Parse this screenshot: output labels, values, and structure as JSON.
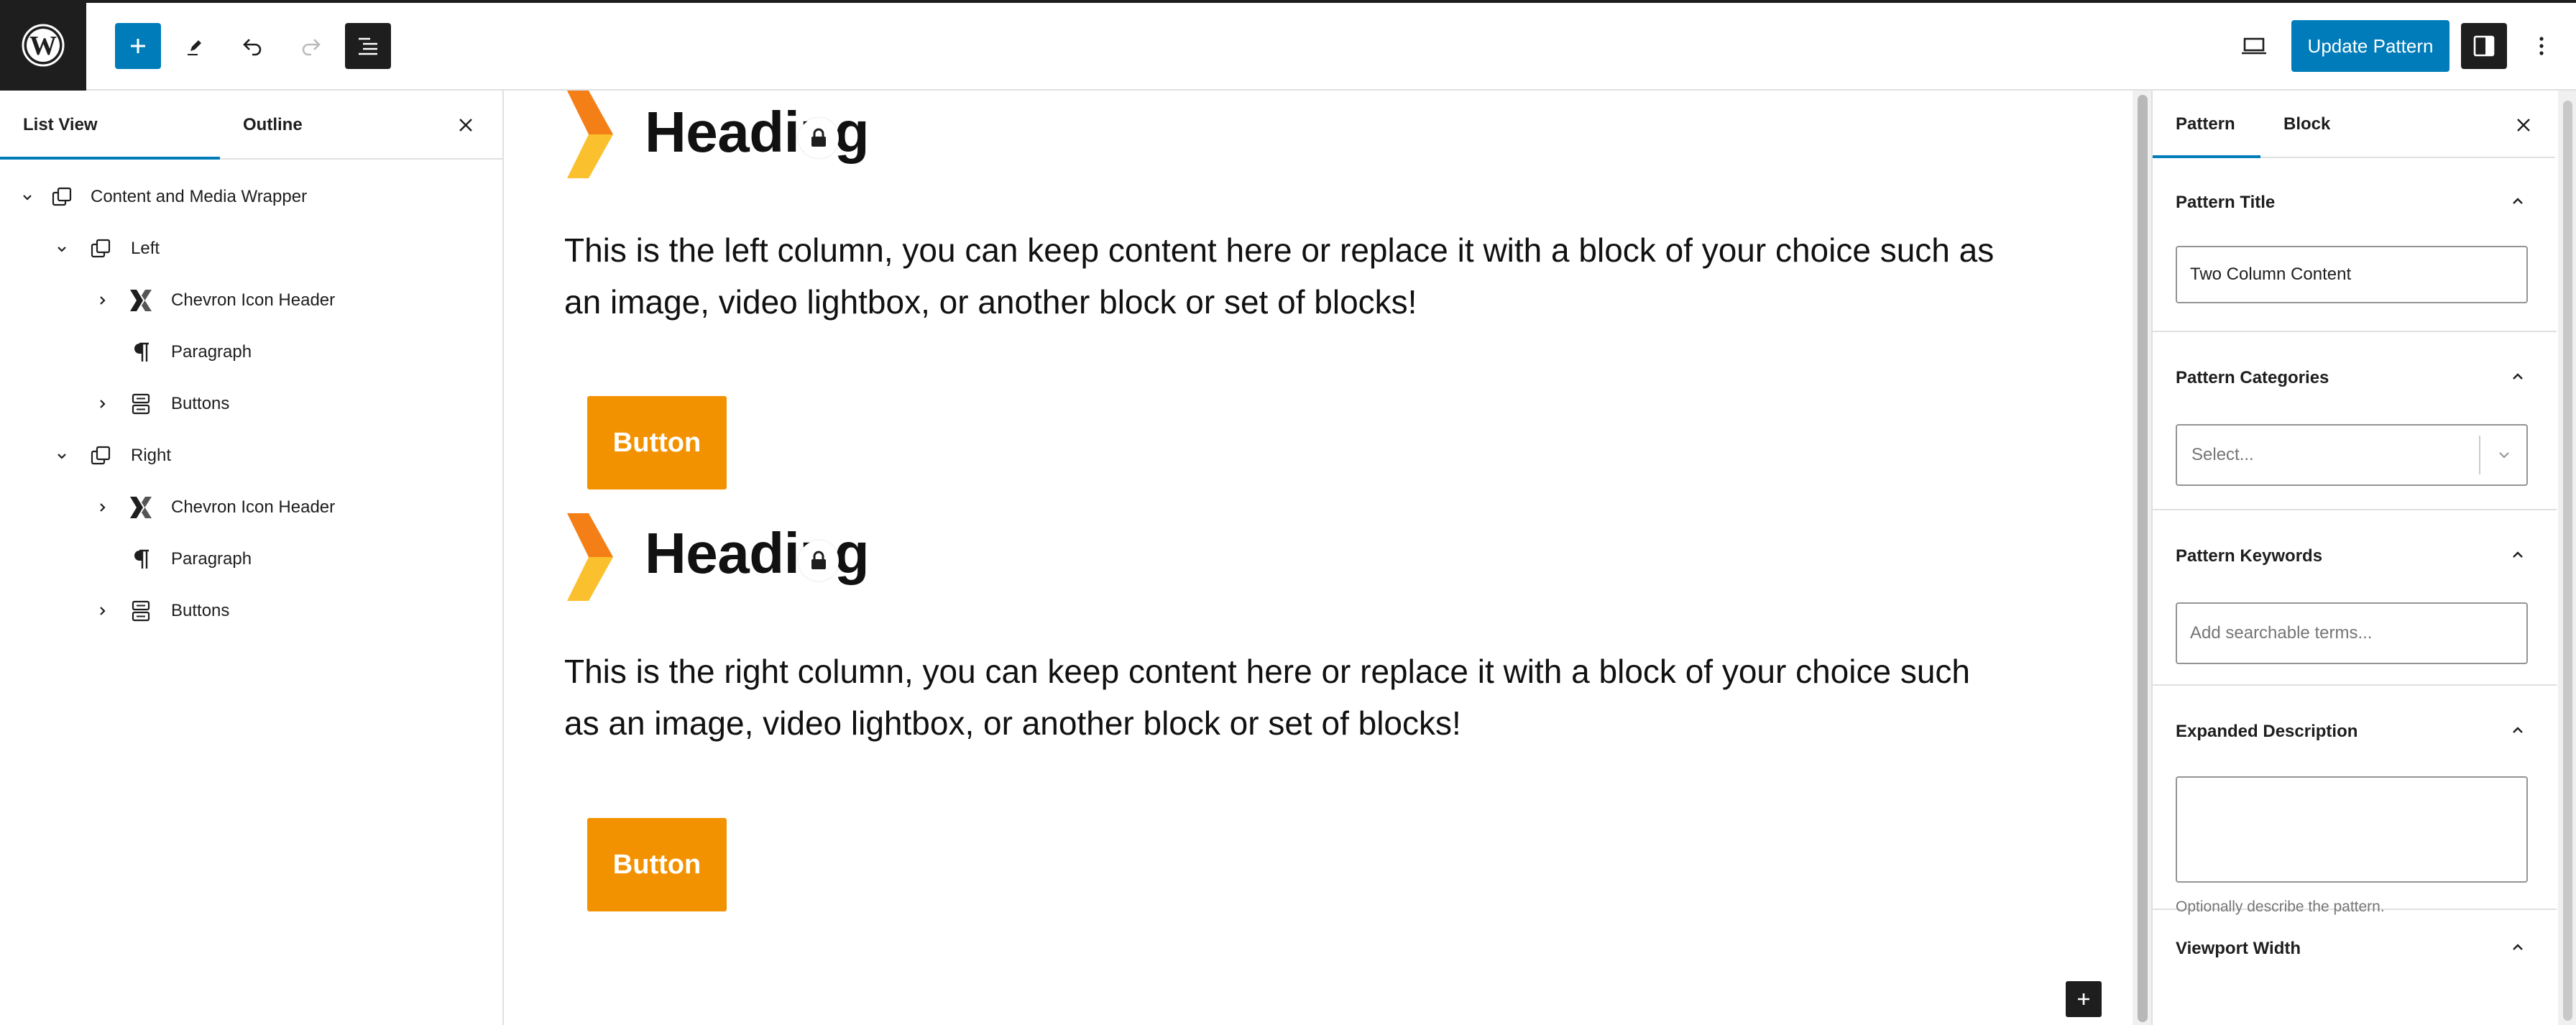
{
  "toolbar": {
    "logo": "wordpress-logo",
    "update_label": "Update Pattern",
    "icons": [
      "plus-icon",
      "pencil-icon",
      "undo-icon",
      "redo-icon",
      "list-view-icon",
      "desktop-preview-icon",
      "sidebar-settings-icon",
      "more-vertical-icon"
    ]
  },
  "left_panel": {
    "tabs": [
      {
        "label": "List View",
        "active": true
      },
      {
        "label": "Outline",
        "active": false
      }
    ],
    "tree": [
      {
        "label": "Content and Media Wrapper",
        "level": 1,
        "expanded": true,
        "icon": "group-icon"
      },
      {
        "label": "Left",
        "level": 2,
        "expanded": true,
        "icon": "group-icon"
      },
      {
        "label": "Chevron Icon Header",
        "level": 3,
        "expanded": false,
        "icon": "chevron-header-icon"
      },
      {
        "label": "Paragraph",
        "level": 3,
        "expanded": null,
        "icon": "paragraph-icon"
      },
      {
        "label": "Buttons",
        "level": 3,
        "expanded": false,
        "icon": "buttons-icon"
      },
      {
        "label": "Right",
        "level": 2,
        "expanded": true,
        "icon": "group-icon"
      },
      {
        "label": "Chevron Icon Header",
        "level": 3,
        "expanded": false,
        "icon": "chevron-header-icon"
      },
      {
        "label": "Paragraph",
        "level": 3,
        "expanded": null,
        "icon": "paragraph-icon"
      },
      {
        "label": "Buttons",
        "level": 3,
        "expanded": false,
        "icon": "buttons-icon"
      }
    ]
  },
  "canvas": {
    "left": {
      "heading": "Heading",
      "paragraph_line1": "This is the left column, you can keep content here or replace it with a block of your choice such as",
      "paragraph_line2": "an image, video lightbox, or another block or set of blocks!",
      "button": "Button"
    },
    "right": {
      "heading": "Heading",
      "paragraph_line1": "This is the right column, you can keep content here or replace it with a block of your choice such",
      "paragraph_line2": "as an image, video lightbox, or another block or set of blocks!",
      "button": "Button"
    },
    "colors": {
      "accent_orange": "#f39200",
      "chevron_dark": "#f57f17",
      "chevron_light": "#fbc02d"
    }
  },
  "right_panel": {
    "tabs": [
      {
        "label": "Pattern",
        "active": true
      },
      {
        "label": "Block",
        "active": false
      }
    ],
    "sections": {
      "title": {
        "label": "Pattern Title",
        "value": "Two Column Content"
      },
      "categories": {
        "label": "Pattern Categories",
        "placeholder": "Select..."
      },
      "keywords": {
        "label": "Pattern Keywords",
        "placeholder": "Add searchable terms..."
      },
      "description": {
        "label": "Expanded Description",
        "value": "",
        "help": "Optionally describe the pattern."
      },
      "viewport": {
        "label": "Viewport Width"
      }
    }
  },
  "colors": {
    "wp_blue": "#007cba",
    "dark": "#1e1e1e",
    "border": "#e0e0e0"
  }
}
